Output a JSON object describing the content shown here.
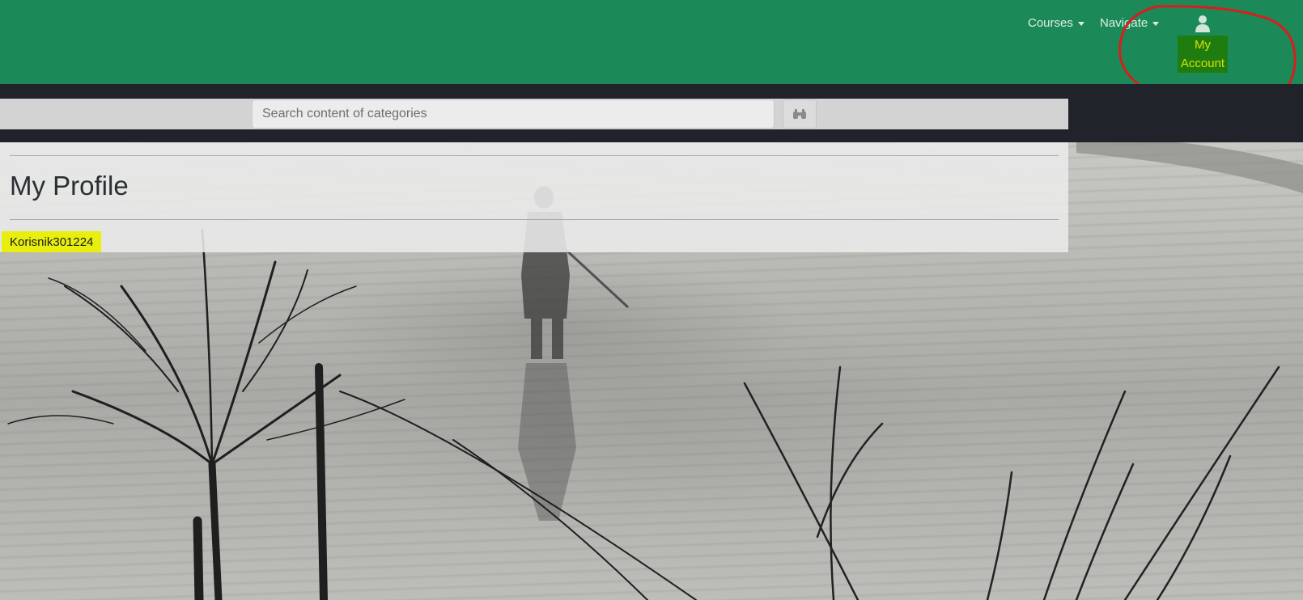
{
  "nav": {
    "courses_label": "Courses",
    "navigate_label": "Navigate",
    "account_label_line1": "My",
    "account_label_line2": "Account",
    "account_icon": "user-icon"
  },
  "search": {
    "placeholder": "Search content of categories",
    "button_icon": "binoculars-icon"
  },
  "profile": {
    "title": "My Profile",
    "username": "Korisnik301224"
  },
  "colors": {
    "navbar": "#1c8a58",
    "dark_band": "#202329",
    "account_highlight": "#1f7d10",
    "username_highlight": "#e8ef0e",
    "annotation": "#d61f1f"
  }
}
